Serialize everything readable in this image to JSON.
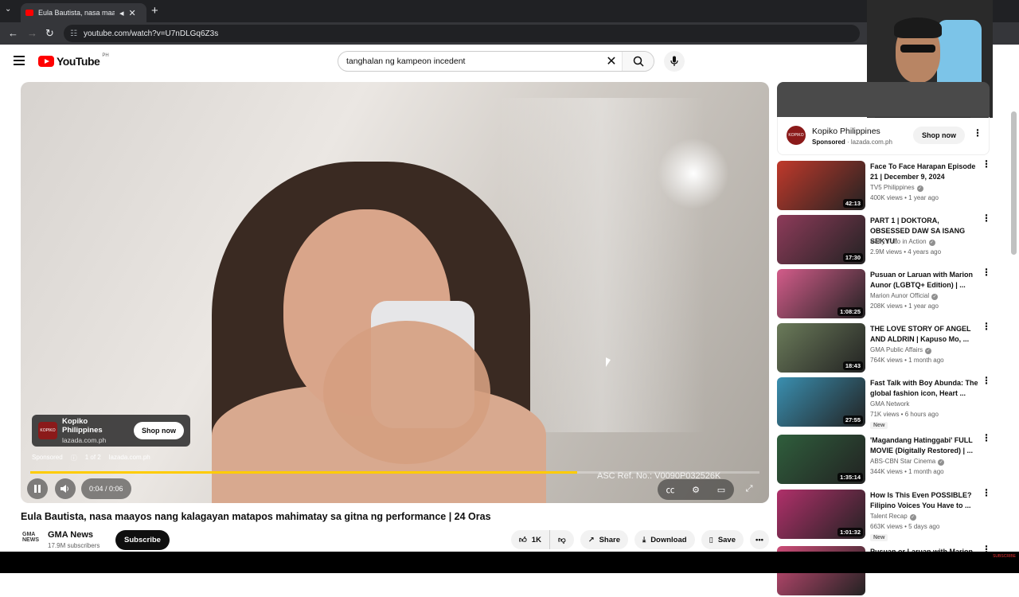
{
  "browser": {
    "tab_title": "Eula Bautista, nasa maayos",
    "url": "youtube.com/watch?v=U7nDLGq6Z3s"
  },
  "header": {
    "logo_text": "YouTube",
    "country": "PH",
    "search_value": "tanghalan ng kampeon incedent"
  },
  "player": {
    "ad_brand": "Kopiko Philippines",
    "ad_domain": "lazada.com.ph",
    "ad_logo_text": "KOPIKO",
    "shop_now": "Shop now",
    "sponsored": "Sponsored",
    "ad_count": "1 of 2",
    "ad_domain2": "lazada.com.ph",
    "asc_ref": "ASC Ref. No.: V0090P032526K",
    "time": "0:04 / 0:06",
    "progress": 0.75
  },
  "video": {
    "title": "Eula Bautista, nasa maayos nang kalagayan matapos mahimatay sa gitna ng performance | 24 Oras",
    "channel": "GMA News",
    "channel_logo": "GMA NEWS",
    "subscribers": "17.9M subscribers",
    "subscribe_label": "Subscribe",
    "likes": "1K",
    "share": "Share",
    "download": "Download",
    "save": "Save"
  },
  "sidebar_ad": {
    "brand": "Kopiko Philippines",
    "logo_text": "KOPIKO",
    "sponsored": "Sponsored",
    "domain": "lazada.com.ph",
    "shop_now": "Shop now"
  },
  "recommendations": [
    {
      "title": "Face To Face Harapan Episode 21 | December 9, 2024",
      "channel": "TV5 Philippines",
      "verified": true,
      "views": "400K views • 1 year ago",
      "duration": "42:13",
      "thumb": "#c0392b"
    },
    {
      "title": "PART 1 | DOKTORA, OBSESSED DAW SA ISANG SEKYU!",
      "channel": "Raffy Tulfo in Action",
      "verified": true,
      "views": "2.9M views • 4 years ago",
      "duration": "17:30",
      "thumb": "#8e3b5a"
    },
    {
      "title": "Pusuan or Laruan with Marion Aunor (LGBTQ+ Edition) | ...",
      "channel": "Marion Aunor Official",
      "verified": true,
      "views": "208K views • 1 year ago",
      "duration": "1:08:25",
      "thumb": "#d35c8a"
    },
    {
      "title": "THE LOVE STORY OF ANGEL AND ALDRIN | Kapuso Mo, ...",
      "channel": "GMA Public Affairs",
      "verified": true,
      "views": "764K views • 1 month ago",
      "duration": "18:43",
      "thumb": "#6b7b5a"
    },
    {
      "title": "Fast Talk with Boy Abunda: The global fashion icon, Heart ...",
      "channel": "GMA Network",
      "verified": false,
      "views": "71K views • 6 hours ago",
      "duration": "27:55",
      "badge": "New",
      "thumb": "#3a8fb0"
    },
    {
      "title": "'Magandang Hatinggabi' FULL MOVIE (Digitally Restored) | ...",
      "channel": "ABS-CBN Star Cinema",
      "verified": true,
      "views": "344K views • 1 month ago",
      "duration": "1:35:14",
      "thumb": "#2f5e3c"
    },
    {
      "title": "How Is This Even POSSIBLE? Filipino Voices You Have to ...",
      "channel": "Talent Recap",
      "verified": true,
      "views": "663K views • 5 days ago",
      "duration": "1:01:32",
      "badge": "New",
      "thumb": "#b0306a"
    },
    {
      "title": "Pusuan or Laruan with Marion",
      "channel": "",
      "verified": false,
      "views": "",
      "duration": "",
      "thumb": "#cc4c77"
    }
  ],
  "taskbar": {
    "subscribe_badge": "SUBSCRIBE"
  }
}
